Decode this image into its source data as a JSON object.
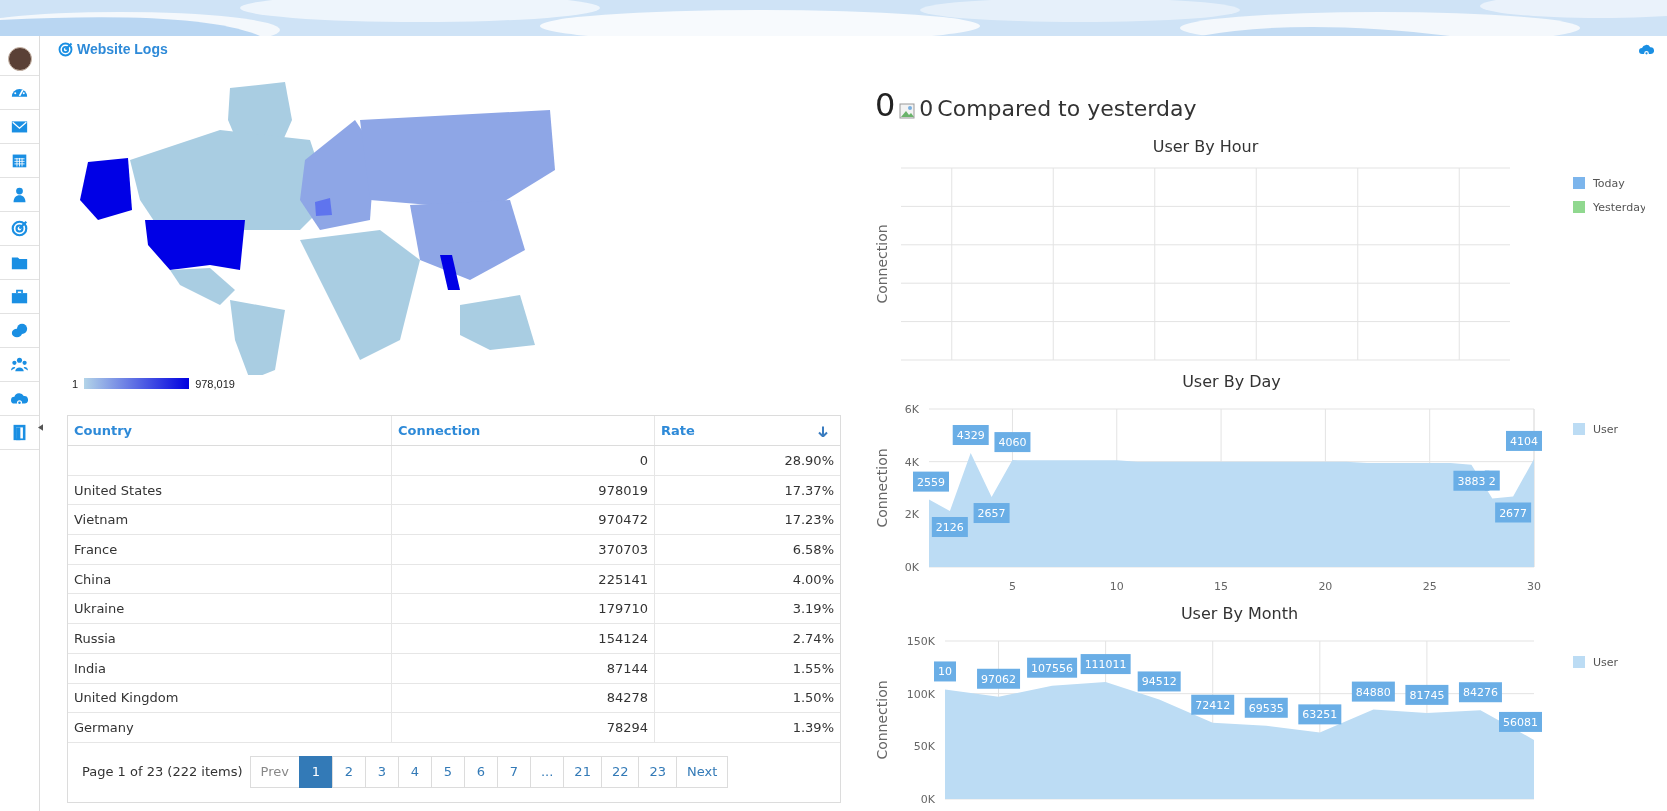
{
  "header": {
    "title": "Website Logs"
  },
  "map": {
    "kind": "picture",
    "legend": {
      "min": "1",
      "max": "978,019"
    }
  },
  "table": {
    "columns": [
      {
        "label": "Country",
        "sorted": false
      },
      {
        "label": "Connection",
        "sorted": false
      },
      {
        "label": "Rate",
        "sorted": true
      }
    ],
    "rows": [
      {
        "connection": "0",
        "rate": "28.90%"
      },
      {
        "country": "United States",
        "connection": "978019",
        "rate": "17.37%"
      },
      {
        "country": "Vietnam",
        "connection": "970472",
        "rate": "17.23%"
      },
      {
        "country": "France",
        "connection": "370703",
        "rate": "6.58%"
      },
      {
        "country": "China",
        "connection": "225141",
        "rate": "4.00%"
      },
      {
        "country": "Ukraine",
        "connection": "179710",
        "rate": "3.19%"
      },
      {
        "country": "Russia",
        "connection": "154124",
        "rate": "2.74%"
      },
      {
        "country": "India",
        "connection": "87144",
        "rate": "1.55%"
      },
      {
        "country": "United Kingdom",
        "connection": "84278",
        "rate": "1.50%"
      },
      {
        "country": "Germany",
        "connection": "78294",
        "rate": "1.39%"
      }
    ],
    "pager": {
      "summary": "Page 1 of 23 (222 items)",
      "prev": "Prev",
      "next": "Next",
      "pages": [
        {
          "label": "1",
          "selected": true
        },
        {
          "label": "2",
          "selected": false
        },
        {
          "label": "3",
          "selected": false
        },
        {
          "label": "4",
          "selected": false
        },
        {
          "label": "5",
          "selected": false
        },
        {
          "label": "6",
          "selected": false
        },
        {
          "label": "7",
          "selected": false
        },
        {
          "label": "...",
          "selected": false
        },
        {
          "label": "21",
          "selected": false
        },
        {
          "label": "22",
          "selected": false
        },
        {
          "label": "23",
          "selected": false
        }
      ]
    }
  },
  "summary": {
    "count": "0",
    "change": "0",
    "label": "Compared to yesterday"
  },
  "charts": [
    {
      "title": "User By Hour",
      "ylabel": "Connection",
      "legend": [
        {
          "name": "Today",
          "color": "#7cb5ec"
        },
        {
          "name": "Yesterday",
          "color": "#90d88f"
        }
      ]
    },
    {
      "chart_data": {
        "type": "area",
        "title": "User By Day",
        "ylabel": "Connection",
        "grid": true,
        "x": [
          1,
          2,
          3,
          4,
          5,
          6,
          7,
          8,
          9,
          10,
          11,
          12,
          13,
          14,
          15,
          16,
          17,
          18,
          19,
          20,
          21,
          22,
          23,
          24,
          25,
          26,
          27,
          28,
          29,
          30
        ],
        "xlim": [
          1,
          30
        ],
        "xticks": [
          5,
          10,
          15,
          20,
          25,
          30
        ],
        "ylim": [
          0,
          6000
        ],
        "yticks": [
          {
            "value": 0,
            "label": "0K"
          },
          {
            "value": 2000,
            "label": "2K"
          },
          {
            "value": 4000,
            "label": "4K"
          },
          {
            "value": 6000,
            "label": "6K"
          }
        ],
        "series": [
          {
            "name": "User",
            "color": "#bcdcf4",
            "values": [
              2559,
              2126,
              4329,
              2657,
              4060,
              4050,
              4050,
              4050,
              4050,
              4050,
              4000,
              4000,
              4000,
              4000,
              4000,
              4000,
              4000,
              4000,
              4000,
              4000,
              4000,
              3950,
              3950,
              3950,
              3950,
              3950,
              3883,
              2600,
              2677,
              4104
            ]
          }
        ],
        "value_labels": [
          "2559",
          "2126",
          "4329",
          "2657",
          "4060",
          null,
          null,
          null,
          null,
          null,
          null,
          null,
          null,
          null,
          null,
          null,
          null,
          null,
          null,
          null,
          null,
          null,
          null,
          null,
          null,
          null,
          "3883",
          "2",
          "2677",
          "4104"
        ]
      }
    },
    {
      "chart_data": {
        "type": "area",
        "title": "User By Month",
        "ylabel": "Connection",
        "grid": true,
        "categories": [
          null,
          null,
          null,
          null,
          null,
          null,
          null,
          null,
          null,
          null,
          null,
          null
        ],
        "ylim": [
          0,
          150000
        ],
        "yticks": [
          {
            "value": 0,
            "label": "0K"
          },
          {
            "value": 50000,
            "label": "50K"
          },
          {
            "value": 100000,
            "label": "100K"
          },
          {
            "value": 150000,
            "label": "150K"
          }
        ],
        "series": [
          {
            "name": "User",
            "color": "#bcdcf4",
            "values": [
              104000,
              97062,
              107556,
              111011,
              94512,
              72412,
              69535,
              63251,
              84880,
              81745,
              84276,
              56081
            ]
          }
        ],
        "value_labels": [
          "10",
          "97062",
          "107556",
          "111011",
          "94512",
          "72412",
          "69535",
          "63251",
          "84880",
          "81745",
          "84276",
          "56081"
        ]
      }
    }
  ]
}
